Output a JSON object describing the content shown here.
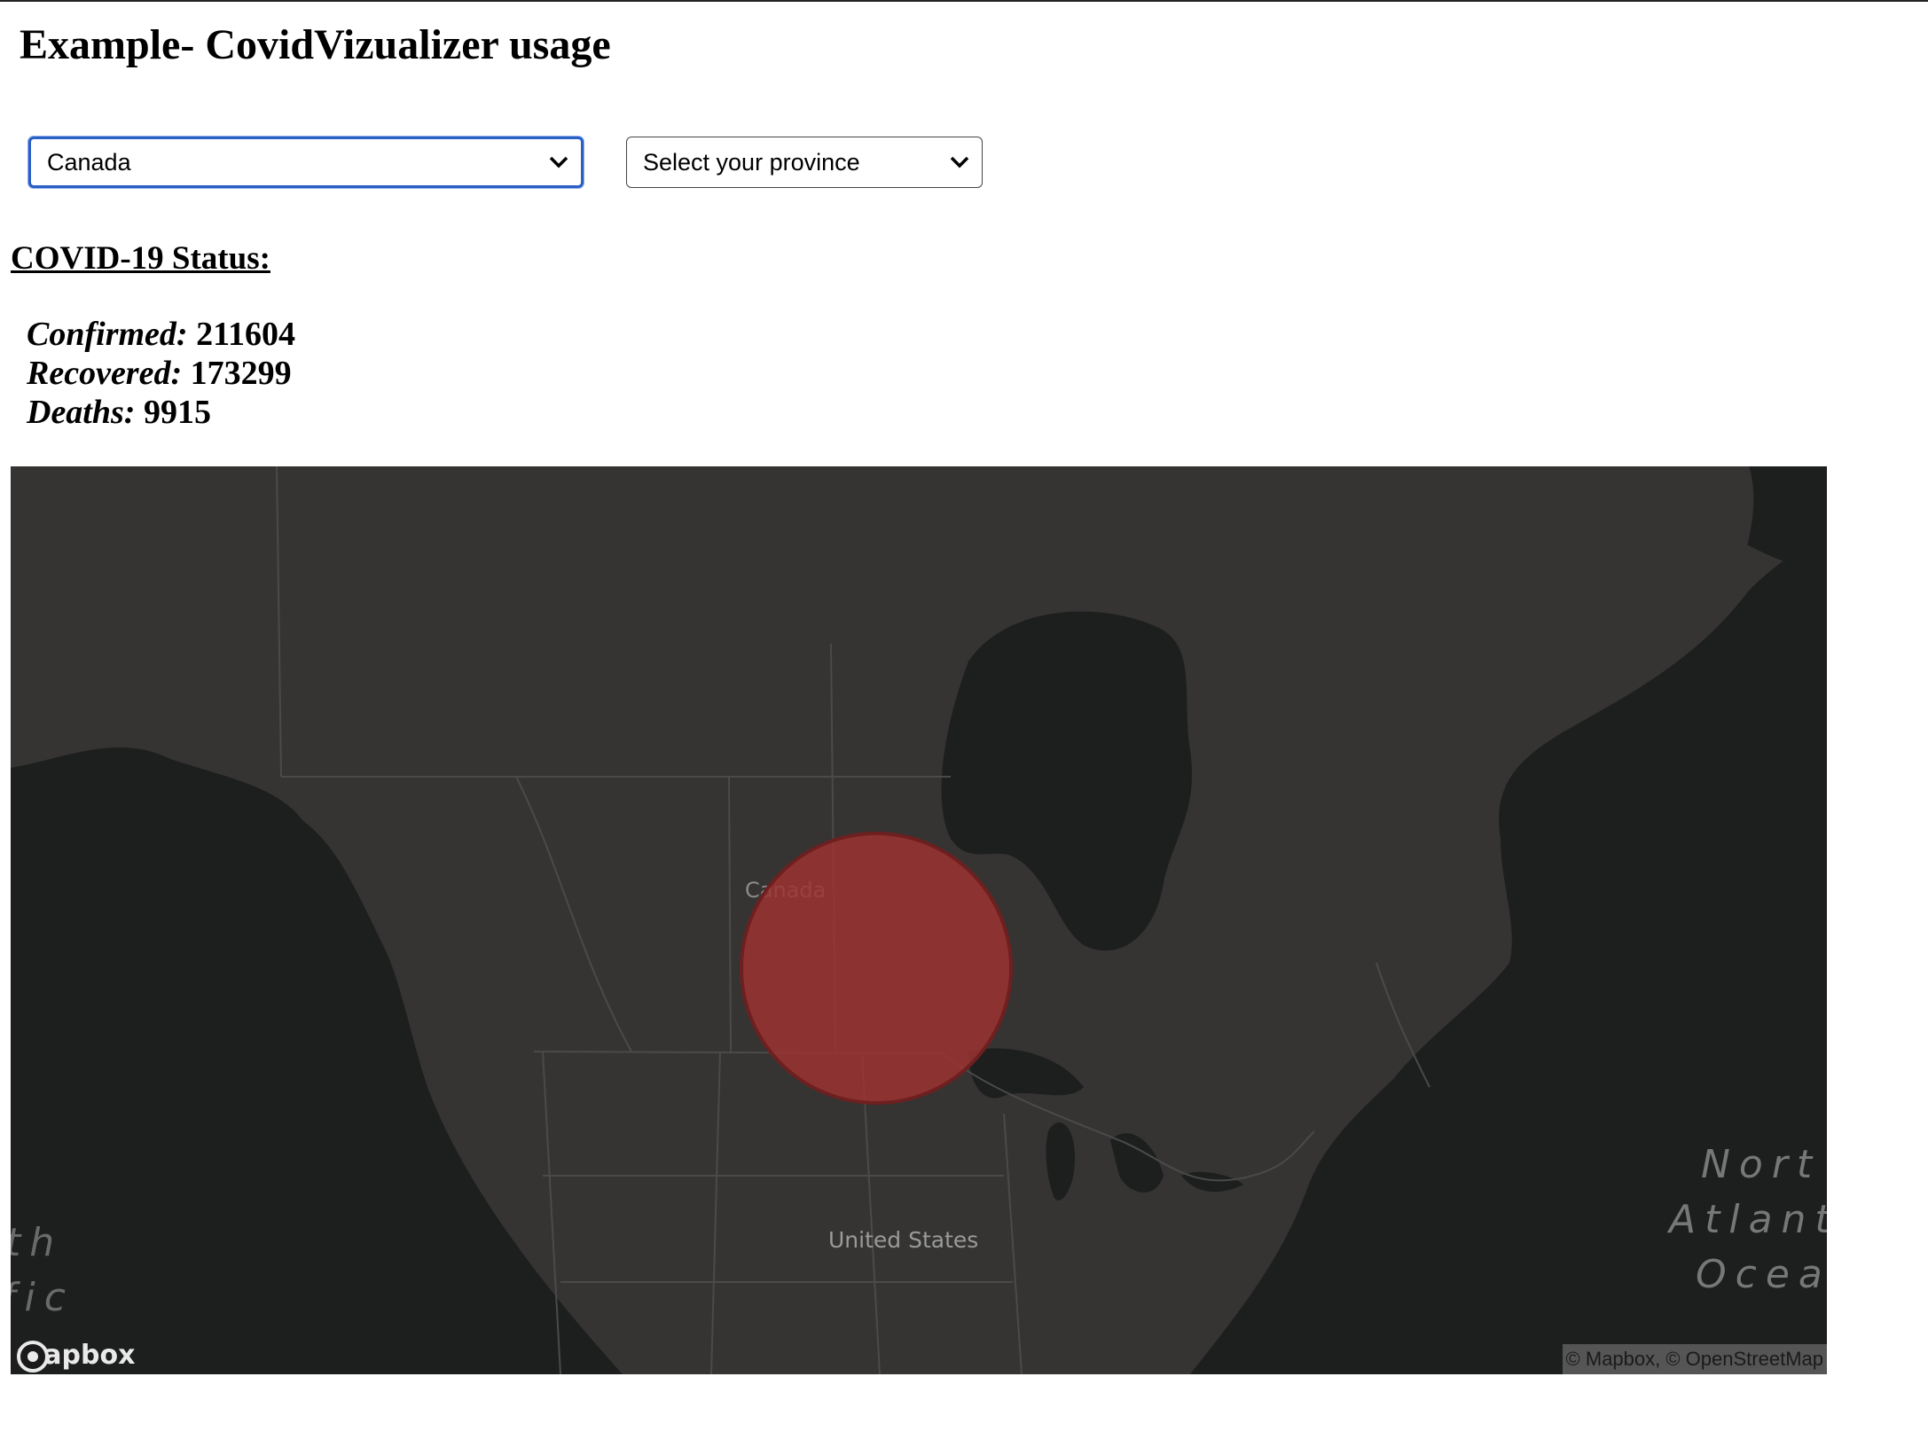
{
  "page": {
    "title": "Example- CovidVizualizer usage"
  },
  "controls": {
    "country_select": {
      "value": "Canada"
    },
    "province_select": {
      "value": "Select your province"
    }
  },
  "status": {
    "heading": "COVID-19 Status:",
    "confirmed_label": "Confirmed:",
    "confirmed_value": "211604",
    "recovered_label": "Recovered:",
    "recovered_value": "173299",
    "deaths_label": "Deaths:",
    "deaths_value": "9915"
  },
  "map": {
    "labels": {
      "canada": "Canada",
      "united_states": "United States",
      "ocean_east_1": "Nort",
      "ocean_east_2": "Atlant",
      "ocean_east_3": "Ocea",
      "ocean_west_1": "th",
      "ocean_west_2": "fic"
    },
    "attribution": "© Mapbox, © OpenStreetMap",
    "logo_text": "mapbox",
    "colors": {
      "land": "#353433",
      "water": "#1d1e1e",
      "marker_fill": "#9b3432",
      "marker_stroke": "#6e1f1f"
    }
  }
}
